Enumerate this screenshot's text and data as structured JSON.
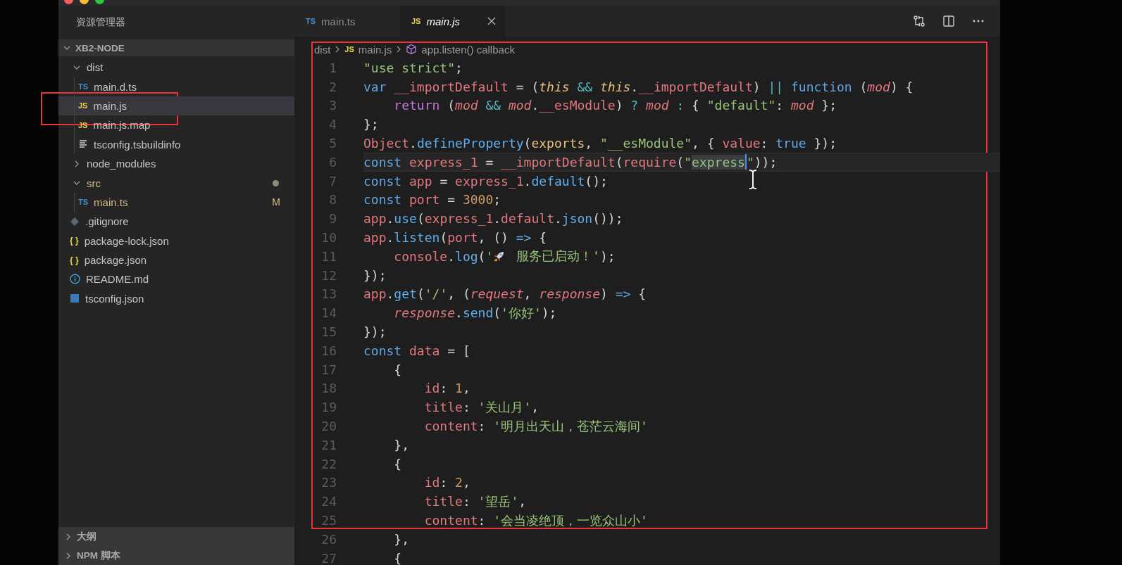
{
  "sidebar": {
    "title": "资源管理器",
    "root": {
      "label": "XB2-NODE",
      "expanded": true
    },
    "tree": [
      {
        "label": "dist",
        "kind": "folder",
        "expanded": true,
        "children": [
          {
            "label": "main.d.ts",
            "kind": "ts",
            "icon_text": "TS",
            "selected": false,
            "marked": false
          },
          {
            "label": "main.js",
            "kind": "js",
            "icon_text": "JS",
            "selected": true,
            "marked": true
          },
          {
            "label": "main.js.map",
            "kind": "js",
            "icon_text": "JS",
            "selected": false,
            "marked": false
          },
          {
            "label": "tsconfig.tsbuildinfo",
            "kind": "text",
            "selected": false,
            "marked": false
          }
        ]
      },
      {
        "label": "node_modules",
        "kind": "folder",
        "expanded": false
      },
      {
        "label": "src",
        "kind": "folder",
        "expanded": true,
        "modified": true,
        "children": [
          {
            "label": "main.ts",
            "kind": "ts",
            "icon_text": "TS",
            "selected": false,
            "marked": false,
            "modified": true,
            "badge": "M"
          }
        ]
      },
      {
        "label": ".gitignore",
        "kind": "git",
        "selected": false,
        "marked": false
      },
      {
        "label": "package-lock.json",
        "kind": "json",
        "icon_text": "{ }",
        "selected": false,
        "marked": false
      },
      {
        "label": "package.json",
        "kind": "json",
        "icon_text": "{ }",
        "selected": false,
        "marked": false
      },
      {
        "label": "README.md",
        "kind": "info",
        "selected": false,
        "marked": false
      },
      {
        "label": "tsconfig.json",
        "kind": "tsconfig",
        "selected": false,
        "marked": false
      }
    ],
    "sections": [
      {
        "label": "大纲",
        "expanded": false
      },
      {
        "label": "NPM 脚本",
        "expanded": false
      }
    ]
  },
  "tabs": [
    {
      "label": "main.ts",
      "kind": "ts",
      "icon_text": "TS",
      "selected": false
    },
    {
      "label": "main.js",
      "kind": "js",
      "icon_text": "JS",
      "selected": true
    }
  ],
  "breadcrumb": {
    "folder": "dist",
    "file": "main.js",
    "file_icon_text": "JS",
    "symbol": "app.listen() callback"
  },
  "editor": {
    "marked": true,
    "lines": [
      {
        "n": "1",
        "tokens": [
          {
            "text": "\"use strict\"",
            "kind": "s"
          },
          {
            "text": ";",
            "kind": "p"
          }
        ]
      },
      {
        "n": "2",
        "tokens": [
          {
            "text": "var ",
            "kind": "k"
          },
          {
            "text": "__importDefault",
            "kind": "v"
          },
          {
            "text": " = (",
            "kind": "p"
          },
          {
            "text": "this",
            "kind": "t"
          },
          {
            "text": " && ",
            "kind": "o"
          },
          {
            "text": "this",
            "kind": "t"
          },
          {
            "text": ".",
            "kind": "p"
          },
          {
            "text": "__importDefault",
            "kind": "v"
          },
          {
            "text": ") ",
            "kind": "p"
          },
          {
            "text": "|| ",
            "kind": "o"
          },
          {
            "text": "function",
            "kind": "k"
          },
          {
            "text": " (",
            "kind": "p"
          },
          {
            "text": "mod",
            "kind": "vi"
          },
          {
            "text": ") {",
            "kind": "p"
          }
        ]
      },
      {
        "n": "3",
        "tokens": [
          {
            "text": "    return",
            "kind": "r"
          },
          {
            "text": " (",
            "kind": "p"
          },
          {
            "text": "mod",
            "kind": "vi"
          },
          {
            "text": " && ",
            "kind": "o"
          },
          {
            "text": "mod",
            "kind": "vi"
          },
          {
            "text": ".",
            "kind": "p"
          },
          {
            "text": "__esModule",
            "kind": "v"
          },
          {
            "text": ") ",
            "kind": "p"
          },
          {
            "text": "? ",
            "kind": "o"
          },
          {
            "text": "mod",
            "kind": "vi"
          },
          {
            "text": " : ",
            "kind": "o"
          },
          {
            "text": "{ ",
            "kind": "p"
          },
          {
            "text": "\"default\"",
            "kind": "s"
          },
          {
            "text": ": ",
            "kind": "p"
          },
          {
            "text": "mod",
            "kind": "vi"
          },
          {
            "text": " };",
            "kind": "p"
          }
        ]
      },
      {
        "n": "4",
        "tokens": [
          {
            "text": "};",
            "kind": "p"
          }
        ]
      },
      {
        "n": "5",
        "tokens": [
          {
            "text": "Object",
            "kind": "v"
          },
          {
            "text": ".",
            "kind": "p"
          },
          {
            "text": "defineProperty",
            "kind": "f"
          },
          {
            "text": "(",
            "kind": "p"
          },
          {
            "text": "exports",
            "kind": "y"
          },
          {
            "text": ", ",
            "kind": "p"
          },
          {
            "text": "\"__esModule\"",
            "kind": "s"
          },
          {
            "text": ", { ",
            "kind": "p"
          },
          {
            "text": "value",
            "kind": "v"
          },
          {
            "text": ": ",
            "kind": "p"
          },
          {
            "text": "true",
            "kind": "k"
          },
          {
            "text": " });",
            "kind": "p"
          }
        ]
      },
      {
        "n": "6",
        "current": true,
        "tokens": [
          {
            "text": "const ",
            "kind": "k"
          },
          {
            "text": "express_1",
            "kind": "v"
          },
          {
            "text": " = ",
            "kind": "p"
          },
          {
            "text": "__importDefault",
            "kind": "v"
          },
          {
            "text": "(",
            "kind": "p"
          },
          {
            "text": "require",
            "kind": "v"
          },
          {
            "text": "(",
            "kind": "p"
          },
          {
            "text": "\"",
            "kind": "s"
          },
          {
            "text": "express",
            "kind": "s",
            "selected": true
          },
          {
            "text": "\"",
            "kind": "s"
          },
          {
            "text": "));",
            "kind": "p"
          }
        ]
      },
      {
        "n": "7",
        "tokens": [
          {
            "text": "const ",
            "kind": "k"
          },
          {
            "text": "app",
            "kind": "v"
          },
          {
            "text": " = ",
            "kind": "p"
          },
          {
            "text": "express_1",
            "kind": "v"
          },
          {
            "text": ".",
            "kind": "p"
          },
          {
            "text": "default",
            "kind": "f"
          },
          {
            "text": "();",
            "kind": "p"
          }
        ]
      },
      {
        "n": "8",
        "tokens": [
          {
            "text": "const ",
            "kind": "k"
          },
          {
            "text": "port",
            "kind": "v"
          },
          {
            "text": " = ",
            "kind": "p"
          },
          {
            "text": "3000",
            "kind": "n"
          },
          {
            "text": ";",
            "kind": "p"
          }
        ]
      },
      {
        "n": "9",
        "tokens": [
          {
            "text": "app",
            "kind": "v"
          },
          {
            "text": ".",
            "kind": "p"
          },
          {
            "text": "use",
            "kind": "f"
          },
          {
            "text": "(",
            "kind": "p"
          },
          {
            "text": "express_1",
            "kind": "v"
          },
          {
            "text": ".",
            "kind": "p"
          },
          {
            "text": "default",
            "kind": "v"
          },
          {
            "text": ".",
            "kind": "p"
          },
          {
            "text": "json",
            "kind": "f"
          },
          {
            "text": "());",
            "kind": "p"
          }
        ]
      },
      {
        "n": "10",
        "tokens": [
          {
            "text": "app",
            "kind": "v"
          },
          {
            "text": ".",
            "kind": "p"
          },
          {
            "text": "listen",
            "kind": "f"
          },
          {
            "text": "(",
            "kind": "p"
          },
          {
            "text": "port",
            "kind": "v"
          },
          {
            "text": ", () ",
            "kind": "p"
          },
          {
            "text": "=>",
            "kind": "k"
          },
          {
            "text": " {",
            "kind": "p"
          }
        ]
      },
      {
        "n": "11",
        "tokens": [
          {
            "text": "    console",
            "kind": "v"
          },
          {
            "text": ".",
            "kind": "p"
          },
          {
            "text": "log",
            "kind": "f"
          },
          {
            "text": "(",
            "kind": "p"
          },
          {
            "text": "'",
            "kind": "s"
          },
          {
            "kind": "rocket"
          },
          {
            "text": " 服务已启动！'",
            "kind": "s"
          },
          {
            "text": ");",
            "kind": "p"
          }
        ]
      },
      {
        "n": "12",
        "tokens": [
          {
            "text": "});",
            "kind": "p"
          }
        ]
      },
      {
        "n": "13",
        "tokens": [
          {
            "text": "app",
            "kind": "v"
          },
          {
            "text": ".",
            "kind": "p"
          },
          {
            "text": "get",
            "kind": "f"
          },
          {
            "text": "(",
            "kind": "p"
          },
          {
            "text": "'/'",
            "kind": "s"
          },
          {
            "text": ", (",
            "kind": "p"
          },
          {
            "text": "request",
            "kind": "vi"
          },
          {
            "text": ", ",
            "kind": "p"
          },
          {
            "text": "response",
            "kind": "vi"
          },
          {
            "text": ") ",
            "kind": "p"
          },
          {
            "text": "=>",
            "kind": "k"
          },
          {
            "text": " {",
            "kind": "p"
          }
        ]
      },
      {
        "n": "14",
        "tokens": [
          {
            "text": "    response",
            "kind": "vi"
          },
          {
            "text": ".",
            "kind": "p"
          },
          {
            "text": "send",
            "kind": "f"
          },
          {
            "text": "(",
            "kind": "p"
          },
          {
            "text": "'你好'",
            "kind": "s"
          },
          {
            "text": ");",
            "kind": "p"
          }
        ]
      },
      {
        "n": "15",
        "tokens": [
          {
            "text": "});",
            "kind": "p"
          }
        ]
      },
      {
        "n": "16",
        "tokens": [
          {
            "text": "const ",
            "kind": "k"
          },
          {
            "text": "data",
            "kind": "v"
          },
          {
            "text": " = [",
            "kind": "p"
          }
        ]
      },
      {
        "n": "17",
        "tokens": [
          {
            "text": "    {",
            "kind": "p"
          }
        ]
      },
      {
        "n": "18",
        "tokens": [
          {
            "text": "        id",
            "kind": "v"
          },
          {
            "text": ": ",
            "kind": "p"
          },
          {
            "text": "1",
            "kind": "n"
          },
          {
            "text": ",",
            "kind": "p"
          }
        ]
      },
      {
        "n": "19",
        "tokens": [
          {
            "text": "        title",
            "kind": "v"
          },
          {
            "text": ": ",
            "kind": "p"
          },
          {
            "text": "'关山月'",
            "kind": "s"
          },
          {
            "text": ",",
            "kind": "p"
          }
        ]
      },
      {
        "n": "20",
        "tokens": [
          {
            "text": "        content",
            "kind": "v"
          },
          {
            "text": ": ",
            "kind": "p"
          },
          {
            "text": "'明月出天山，苍茫云海间'",
            "kind": "s"
          }
        ]
      },
      {
        "n": "21",
        "tokens": [
          {
            "text": "    },",
            "kind": "p"
          }
        ]
      },
      {
        "n": "22",
        "tokens": [
          {
            "text": "    {",
            "kind": "p"
          }
        ]
      },
      {
        "n": "23",
        "tokens": [
          {
            "text": "        id",
            "kind": "v"
          },
          {
            "text": ": ",
            "kind": "p"
          },
          {
            "text": "2",
            "kind": "n"
          },
          {
            "text": ",",
            "kind": "p"
          }
        ]
      },
      {
        "n": "24",
        "tokens": [
          {
            "text": "        title",
            "kind": "v"
          },
          {
            "text": ": ",
            "kind": "p"
          },
          {
            "text": "'望岳'",
            "kind": "s"
          },
          {
            "text": ",",
            "kind": "p"
          }
        ]
      },
      {
        "n": "25",
        "tokens": [
          {
            "text": "        content",
            "kind": "v"
          },
          {
            "text": ": ",
            "kind": "p"
          },
          {
            "text": "'会当凌绝顶，一览众山小'",
            "kind": "s"
          }
        ]
      },
      {
        "n": "26",
        "tokens": [
          {
            "text": "    },",
            "kind": "p"
          }
        ]
      },
      {
        "n": "27",
        "tokens": [
          {
            "text": "    {",
            "kind": "p"
          }
        ]
      }
    ]
  }
}
